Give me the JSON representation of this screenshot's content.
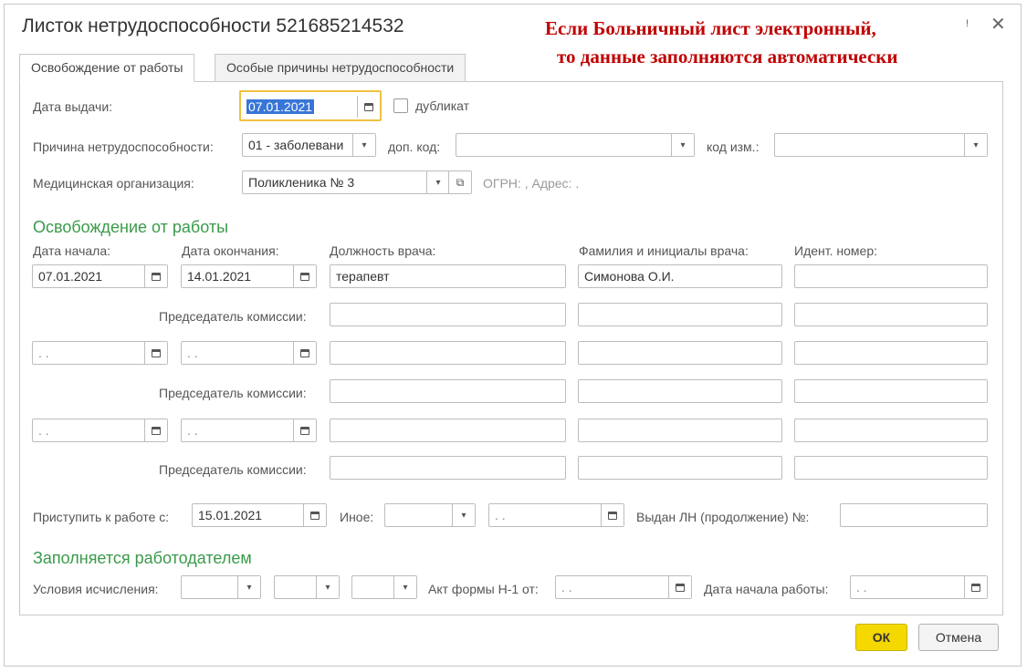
{
  "window": {
    "title": "Листок нетрудоспособности 521685214532",
    "close_icon": "close-icon",
    "extra_mark": "!"
  },
  "annotation": {
    "line1": "Если Больничный лист электронный,",
    "line2": "то данные заполняются автоматически"
  },
  "tabs": [
    {
      "label": "Освобождение от работы",
      "active": true
    },
    {
      "label": "Особые причины нетрудоспособности",
      "active": false
    }
  ],
  "issue": {
    "date_label": "Дата выдачи:",
    "date_value": "07.01.2021",
    "duplicate_label": "дубликат",
    "duplicate_checked": false
  },
  "cause": {
    "label": "Причина нетрудоспособности:",
    "value": "01 - заболевани",
    "extra_code_label": "доп. код:",
    "extra_code_value": "",
    "change_code_label": "код изм.:",
    "change_code_value": ""
  },
  "medical": {
    "label": "Медицинская организация:",
    "value": "Поликленика № 3",
    "info": "ОГРН: , Адрес: ."
  },
  "release": {
    "section_title": "Освобождение от работы",
    "headers": {
      "start": "Дата начала:",
      "end": "Дата окончания:",
      "position": "Должность врача:",
      "doctor": "Фамилия и инициалы врача:",
      "id": "Идент.  номер:"
    },
    "chairman_label": "Председатель комиссии:",
    "rows": [
      {
        "start": "07.01.2021",
        "end": "14.01.2021",
        "position": "терапевт",
        "doctor": "Симонова О.И.",
        "id": ""
      },
      {
        "start": " .  .",
        "end": " .  .",
        "position": "",
        "doctor": "",
        "id": ""
      },
      {
        "start": " .  .",
        "end": " .  .",
        "position": "",
        "doctor": "",
        "id": ""
      }
    ]
  },
  "return": {
    "label": "Приступить к работе с:",
    "value": "15.01.2021",
    "other_label": "Иное:",
    "other_value": "",
    "other_date": " .  .",
    "continuation_label": "Выдан ЛН (продолжение) №:",
    "continuation_value": ""
  },
  "employer": {
    "section_title": "Заполняется работодателем",
    "conditions_label": "Условия исчисления:",
    "act_label": "Акт формы Н-1 от:",
    "act_value": " .  .",
    "work_start_label": "Дата начала работы:",
    "work_start_value": " .  ."
  },
  "buttons": {
    "ok": "ОК",
    "cancel": "Отмена"
  },
  "colors": {
    "accent_green": "#3a9a4a",
    "annotation_red": "#c00000",
    "ok_yellow": "#f5d800",
    "focus_border": "#f0c040"
  }
}
